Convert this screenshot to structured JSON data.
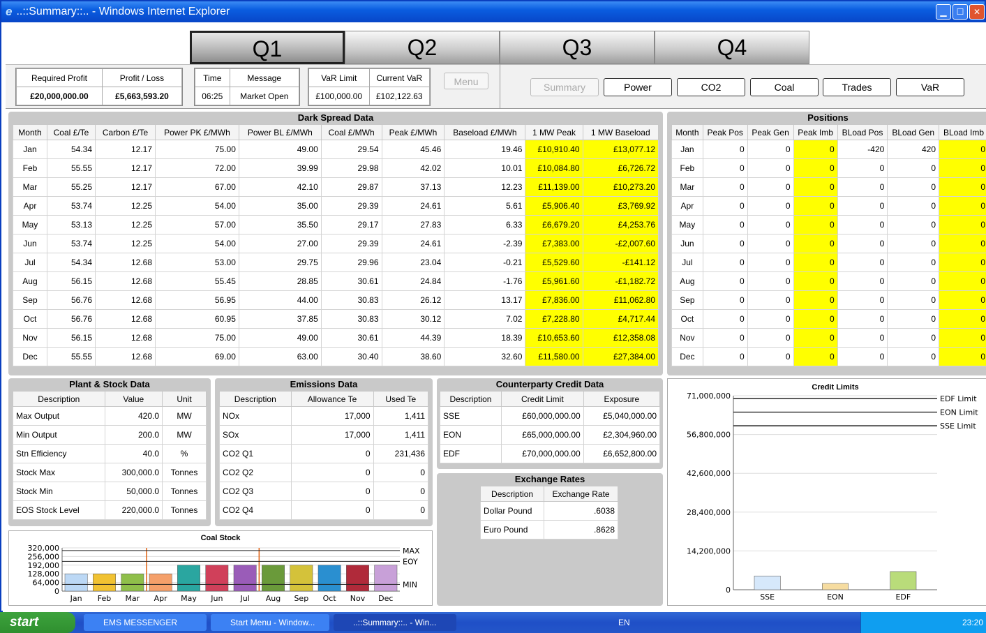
{
  "window": {
    "title": "..::Summary::.. - Windows Internet Explorer"
  },
  "quarters": [
    "Q1",
    "Q2",
    "Q3",
    "Q4"
  ],
  "info": {
    "required_profit_label": "Required Profit",
    "required_profit": "£20,000,000.00",
    "profit_loss_label": "Profit / Loss",
    "profit_loss": "£5,663,593.20",
    "time_label": "Time",
    "time": "06:25",
    "message_label": "Message",
    "message": "Market Open",
    "var_limit_label": "VaR Limit",
    "var_limit": "£100,000.00",
    "current_var_label": "Current VaR",
    "current_var": "£102,122.63",
    "menu": "Menu"
  },
  "nav": [
    "Summary",
    "Power",
    "CO2",
    "Coal",
    "Trades",
    "VaR"
  ],
  "dark_spread": {
    "title": "Dark Spread Data",
    "headers": [
      "Month",
      "Coal £/Te",
      "Carbon £/Te",
      "Power PK £/MWh",
      "Power BL £/MWh",
      "Coal £/MWh",
      "Peak £/MWh",
      "Baseload £/MWh",
      "1 MW Peak",
      "1 MW Baseload"
    ],
    "rows": [
      [
        "Jan",
        "54.34",
        "12.17",
        "75.00",
        "49.00",
        "29.54",
        "45.46",
        "19.46",
        "£10,910.40",
        "£13,077.12"
      ],
      [
        "Feb",
        "55.55",
        "12.17",
        "72.00",
        "39.99",
        "29.98",
        "42.02",
        "10.01",
        "£10,084.80",
        "£6,726.72"
      ],
      [
        "Mar",
        "55.25",
        "12.17",
        "67.00",
        "42.10",
        "29.87",
        "37.13",
        "12.23",
        "£11,139.00",
        "£10,273.20"
      ],
      [
        "Apr",
        "53.74",
        "12.25",
        "54.00",
        "35.00",
        "29.39",
        "24.61",
        "5.61",
        "£5,906.40",
        "£3,769.92"
      ],
      [
        "May",
        "53.13",
        "12.25",
        "57.00",
        "35.50",
        "29.17",
        "27.83",
        "6.33",
        "£6,679.20",
        "£4,253.76"
      ],
      [
        "Jun",
        "53.74",
        "12.25",
        "54.00",
        "27.00",
        "29.39",
        "24.61",
        "-2.39",
        "£7,383.00",
        "-£2,007.60"
      ],
      [
        "Jul",
        "54.34",
        "12.68",
        "53.00",
        "29.75",
        "29.96",
        "23.04",
        "-0.21",
        "£5,529.60",
        "-£141.12"
      ],
      [
        "Aug",
        "56.15",
        "12.68",
        "55.45",
        "28.85",
        "30.61",
        "24.84",
        "-1.76",
        "£5,961.60",
        "-£1,182.72"
      ],
      [
        "Sep",
        "56.76",
        "12.68",
        "56.95",
        "44.00",
        "30.83",
        "26.12",
        "13.17",
        "£7,836.00",
        "£11,062.80"
      ],
      [
        "Oct",
        "56.76",
        "12.68",
        "60.95",
        "37.85",
        "30.83",
        "30.12",
        "7.02",
        "£7,228.80",
        "£4,717.44"
      ],
      [
        "Nov",
        "56.15",
        "12.68",
        "75.00",
        "49.00",
        "30.61",
        "44.39",
        "18.39",
        "£10,653.60",
        "£12,358.08"
      ],
      [
        "Dec",
        "55.55",
        "12.68",
        "69.00",
        "63.00",
        "30.40",
        "38.60",
        "32.60",
        "£11,580.00",
        "£27,384.00"
      ]
    ]
  },
  "positions": {
    "title": "Positions",
    "headers": [
      "Month",
      "Peak Pos",
      "Peak Gen",
      "Peak Imb",
      "BLoad Pos",
      "BLoad Gen",
      "BLoad Imb"
    ],
    "rows": [
      [
        "Jan",
        "0",
        "0",
        "0",
        "-420",
        "420",
        "0"
      ],
      [
        "Feb",
        "0",
        "0",
        "0",
        "0",
        "0",
        "0"
      ],
      [
        "Mar",
        "0",
        "0",
        "0",
        "0",
        "0",
        "0"
      ],
      [
        "Apr",
        "0",
        "0",
        "0",
        "0",
        "0",
        "0"
      ],
      [
        "May",
        "0",
        "0",
        "0",
        "0",
        "0",
        "0"
      ],
      [
        "Jun",
        "0",
        "0",
        "0",
        "0",
        "0",
        "0"
      ],
      [
        "Jul",
        "0",
        "0",
        "0",
        "0",
        "0",
        "0"
      ],
      [
        "Aug",
        "0",
        "0",
        "0",
        "0",
        "0",
        "0"
      ],
      [
        "Sep",
        "0",
        "0",
        "0",
        "0",
        "0",
        "0"
      ],
      [
        "Oct",
        "0",
        "0",
        "0",
        "0",
        "0",
        "0"
      ],
      [
        "Nov",
        "0",
        "0",
        "0",
        "0",
        "0",
        "0"
      ],
      [
        "Dec",
        "0",
        "0",
        "0",
        "0",
        "0",
        "0"
      ]
    ]
  },
  "plant": {
    "title": "Plant & Stock Data",
    "headers": [
      "Description",
      "Value",
      "Unit"
    ],
    "rows": [
      [
        "Max Output",
        "420.0",
        "MW"
      ],
      [
        "Min Output",
        "200.0",
        "MW"
      ],
      [
        "Stn Efficiency",
        "40.0",
        "%"
      ],
      [
        "Stock Max",
        "300,000.0",
        "Tonnes"
      ],
      [
        "Stock Min",
        "50,000.0",
        "Tonnes"
      ],
      [
        "EOS Stock Level",
        "220,000.0",
        "Tonnes"
      ]
    ]
  },
  "emissions": {
    "title": "Emissions Data",
    "headers": [
      "Description",
      "Allowance Te",
      "Used Te"
    ],
    "rows": [
      [
        "NOx",
        "17,000",
        "1,411"
      ],
      [
        "SOx",
        "17,000",
        "1,411"
      ],
      [
        "CO2 Q1",
        "0",
        "231,436"
      ],
      [
        "CO2 Q2",
        "0",
        "0"
      ],
      [
        "CO2 Q3",
        "0",
        "0"
      ],
      [
        "CO2 Q4",
        "0",
        "0"
      ]
    ]
  },
  "credit": {
    "title": "Counterparty Credit Data",
    "headers": [
      "Description",
      "Credit Limit",
      "Exposure"
    ],
    "rows": [
      [
        "SSE",
        "£60,000,000.00",
        "£5,040,000.00"
      ],
      [
        "EON",
        "£65,000,000.00",
        "£2,304,960.00"
      ],
      [
        "EDF",
        "£70,000,000.00",
        "£6,652,800.00"
      ]
    ]
  },
  "exchange": {
    "title": "Exchange Rates",
    "headers": [
      "Description",
      "Exchange Rate"
    ],
    "rows": [
      [
        "Dollar Pound",
        ".6038"
      ],
      [
        "Euro Pound",
        ".8628"
      ]
    ]
  },
  "chart_data": [
    {
      "type": "bar",
      "title": "Coal Stock",
      "categories": [
        "Jan",
        "Feb",
        "Mar",
        "Apr",
        "May",
        "Jun",
        "Jul",
        "Aug",
        "Sep",
        "Oct",
        "Nov",
        "Dec"
      ],
      "values": [
        128000,
        128000,
        128000,
        128000,
        192000,
        192000,
        192000,
        192000,
        192000,
        192000,
        192000,
        192000
      ],
      "colors": [
        "#bcd8f5",
        "#f1c232",
        "#8fbf4a",
        "#f5a06a",
        "#2aa6a0",
        "#d0405a",
        "#9a5cb8",
        "#6a9a3a",
        "#d4c23a",
        "#2a8fd0",
        "#b02a3a",
        "#c8a0d8"
      ],
      "yticks": [
        "320,000",
        "256,000",
        "192,000",
        "128,000",
        "64,000",
        "0"
      ],
      "ylim": [
        0,
        320000
      ],
      "ref_lines": [
        {
          "name": "MAX",
          "value": 300000
        },
        {
          "name": "EOY",
          "value": 220000
        },
        {
          "name": "MIN",
          "value": 50000
        }
      ]
    },
    {
      "type": "bar",
      "title": "Credit Limits",
      "categories": [
        "SSE",
        "EON",
        "EDF"
      ],
      "values": [
        5040000,
        2304960,
        6652800
      ],
      "colors": [
        "#d6e8fb",
        "#f6dca0",
        "#b9dc7a"
      ],
      "yticks": [
        "71,000,000",
        "56,800,000",
        "42,600,000",
        "28,400,000",
        "14,200,000",
        "0"
      ],
      "ylim": [
        0,
        71000000
      ],
      "ref_lines": [
        {
          "name": "EDF Limit",
          "value": 70000000
        },
        {
          "name": "EON Limit",
          "value": 65000000
        },
        {
          "name": "SSE Limit",
          "value": 60000000
        }
      ]
    }
  ],
  "taskbar": {
    "start": "start",
    "tasks": [
      "EMS MESSENGER",
      "Start Menu - Window...",
      "..::Summary::.. - Win..."
    ],
    "lang": "EN",
    "clock": "23:20"
  }
}
